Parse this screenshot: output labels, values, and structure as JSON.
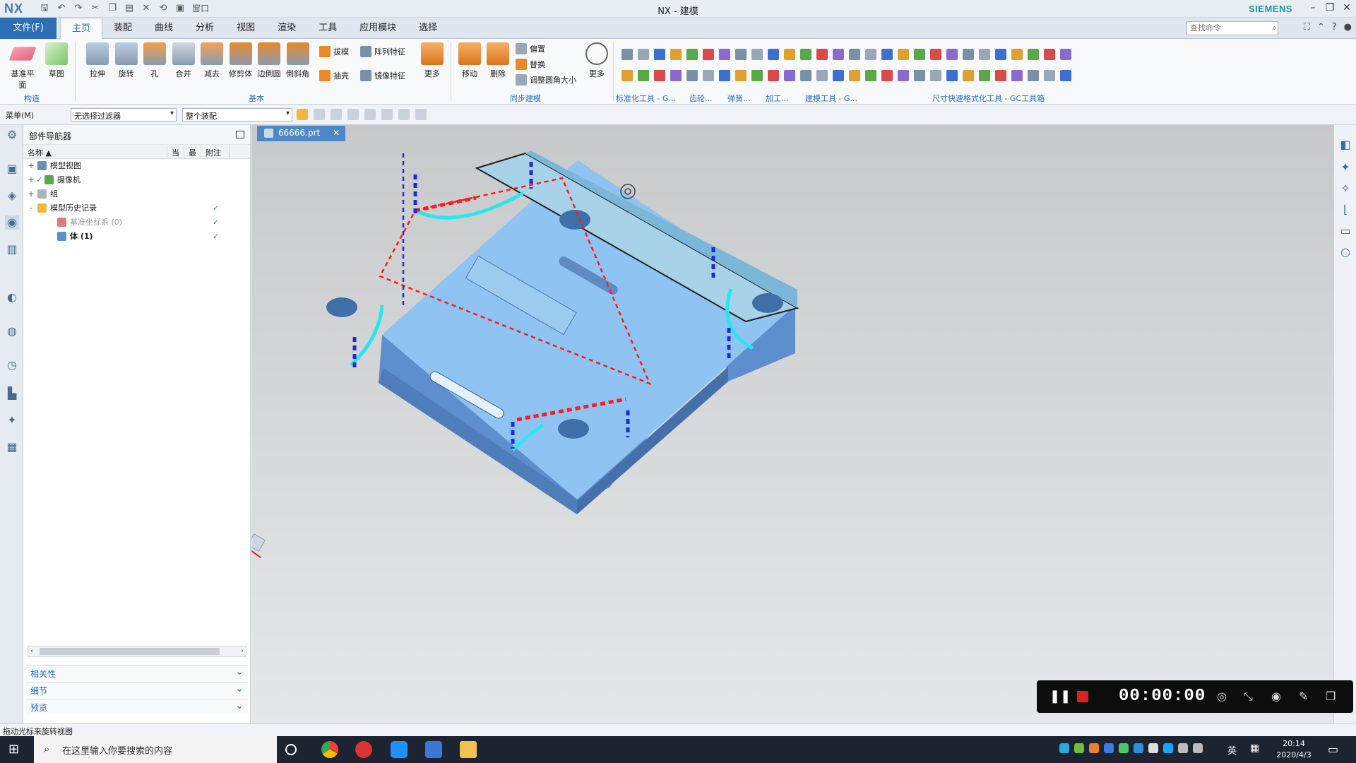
{
  "app": {
    "logo": "NX",
    "title": "NX - 建模",
    "brand": "SIEMENS",
    "quick_access_window_label": "窗口"
  },
  "menu": {
    "file_label": "文件(F)",
    "tabs": [
      "主页",
      "装配",
      "曲线",
      "分析",
      "视图",
      "渲染",
      "工具",
      "应用模块",
      "选择"
    ],
    "active_tab": "主页",
    "search_placeholder": "查找命令"
  },
  "ribbon": {
    "construct": {
      "items": [
        "基准平面",
        "草图"
      ],
      "group": "构造"
    },
    "basic": {
      "items": [
        "拉伸",
        "旋转",
        "孔",
        "合并",
        "减去",
        "修剪体",
        "边倒圆",
        "倒斜角"
      ],
      "small_items": [
        "拔模",
        "阵列特征",
        "抽壳",
        "镜像特征"
      ],
      "more": "更多",
      "group": "基本"
    },
    "sync": {
      "items": [
        "移动",
        "删除"
      ],
      "small_items": [
        "偏置",
        "替换",
        "调整圆角大小"
      ],
      "more": "更多",
      "group": "同步建模"
    },
    "groups_right": [
      "标准化工具 - G...",
      "齿轮...",
      "弹簧...",
      "加工...",
      "建模工具 - G...",
      "尺寸快速格式化工具 - GC工具箱"
    ]
  },
  "selection_bar": {
    "menu_label": "菜单(M)",
    "filter_value": "无选择过滤器",
    "scope_value": "整个装配"
  },
  "navigator": {
    "title": "部件导航器",
    "columns": [
      "名称",
      "当",
      "最",
      "附注"
    ],
    "rows": [
      {
        "label": "模型视图",
        "expand": "+",
        "level": 0,
        "check": false,
        "dim": false,
        "col_check": false
      },
      {
        "label": "摄像机",
        "expand": "+",
        "level": 0,
        "check": true,
        "dim": false,
        "col_check": false
      },
      {
        "label": "组",
        "expand": "+",
        "level": 0,
        "check": false,
        "dim": false,
        "col_check": false
      },
      {
        "label": "模型历史记录",
        "expand": "-",
        "level": 0,
        "check": false,
        "dim": false,
        "col_check": true
      },
      {
        "label": "基准坐标系 (0)",
        "expand": "",
        "level": 1,
        "check": false,
        "dim": true,
        "col_check": true
      },
      {
        "label": "体 (1)",
        "expand": "",
        "level": 1,
        "check": false,
        "dim": false,
        "col_check": true
      }
    ],
    "panels": [
      "相关性",
      "细节",
      "预览"
    ]
  },
  "document_tab": "66666.prt",
  "recorder": {
    "time": "00:00:00"
  },
  "status_text": "拖动光标来旋转视图",
  "taskbar": {
    "search_placeholder": "在这里输入你要搜索的内容",
    "lang": "英",
    "time": "20:14",
    "date": "2020/4/3"
  },
  "colors": {
    "accent": "#2d6fb5",
    "part_face": "#8ec3f2",
    "part_side": "#5d8fcf",
    "highlight": "#29e6f0",
    "dash_red": "#ff1a1a",
    "dash_blue": "#1f2bd6"
  }
}
